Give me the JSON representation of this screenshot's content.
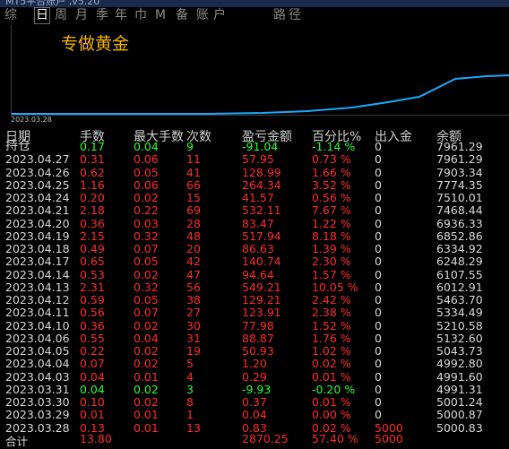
{
  "window": {
    "title": "MT5平台账户 ,v5.20"
  },
  "tabs": [
    {
      "label": "综",
      "active": false
    },
    {
      "label": "日",
      "active": true
    },
    {
      "label": "周",
      "active": false
    },
    {
      "label": "月",
      "active": false
    },
    {
      "label": "季",
      "active": false
    },
    {
      "label": "年",
      "active": false
    },
    {
      "label": "巾",
      "active": false
    },
    {
      "label": "M",
      "active": false
    },
    {
      "label": "备",
      "active": false
    },
    {
      "label": "账",
      "active": false
    },
    {
      "label": "户",
      "active": false
    },
    {
      "label": "路",
      "active": false
    },
    {
      "label": "径",
      "active": false
    }
  ],
  "chart": {
    "title": "专做黄金",
    "start_date": "2023.03.28",
    "line_color": "#1ea7ff"
  },
  "table": {
    "headers": [
      "日期",
      "手数",
      "最大手数",
      "次数",
      "盈亏金额",
      "百分比%",
      "出入金",
      "余额"
    ],
    "position_row": {
      "date": "持仓",
      "lots": "0.17",
      "max_lots": "0.04",
      "trades": "9",
      "profit": "-91.04",
      "percent": "-1.14 %",
      "deposit": "0",
      "balance": "7961.29"
    },
    "rows": [
      {
        "date": "2023.04.27",
        "lots": "0.31",
        "max_lots": "0.06",
        "trades": "11",
        "profit": "57.95",
        "percent": "0.73 %",
        "deposit": "0",
        "balance": "7961.29",
        "color": "red"
      },
      {
        "date": "2023.04.26",
        "lots": "0.62",
        "max_lots": "0.05",
        "trades": "41",
        "profit": "128.99",
        "percent": "1.66 %",
        "deposit": "0",
        "balance": "7903.34",
        "color": "red"
      },
      {
        "date": "2023.04.25",
        "lots": "1.16",
        "max_lots": "0.06",
        "trades": "66",
        "profit": "264.34",
        "percent": "3.52 %",
        "deposit": "0",
        "balance": "7774.35",
        "color": "red"
      },
      {
        "date": "2023.04.24",
        "lots": "0.20",
        "max_lots": "0.02",
        "trades": "15",
        "profit": "41.57",
        "percent": "0.56 %",
        "deposit": "0",
        "balance": "7510.01",
        "color": "red"
      },
      {
        "date": "2023.04.21",
        "lots": "2.18",
        "max_lots": "0.22",
        "trades": "69",
        "profit": "532.11",
        "percent": "7.67 %",
        "deposit": "0",
        "balance": "7468.44",
        "color": "red"
      },
      {
        "date": "2023.04.20",
        "lots": "0.36",
        "max_lots": "0.03",
        "trades": "28",
        "profit": "83.47",
        "percent": "1.22 %",
        "deposit": "0",
        "balance": "6936.33",
        "color": "red"
      },
      {
        "date": "2023.04.19",
        "lots": "2.15",
        "max_lots": "0.32",
        "trades": "48",
        "profit": "517.94",
        "percent": "8.18 %",
        "deposit": "0",
        "balance": "6852.86",
        "color": "red"
      },
      {
        "date": "2023.04.18",
        "lots": "0.49",
        "max_lots": "0.07",
        "trades": "20",
        "profit": "86.63",
        "percent": "1.39 %",
        "deposit": "0",
        "balance": "6334.92",
        "color": "red"
      },
      {
        "date": "2023.04.17",
        "lots": "0.65",
        "max_lots": "0.05",
        "trades": "42",
        "profit": "140.74",
        "percent": "2.30 %",
        "deposit": "0",
        "balance": "6248.29",
        "color": "red"
      },
      {
        "date": "2023.04.14",
        "lots": "0.53",
        "max_lots": "0.02",
        "trades": "47",
        "profit": "94.64",
        "percent": "1.57 %",
        "deposit": "0",
        "balance": "6107.55",
        "color": "red"
      },
      {
        "date": "2023.04.13",
        "lots": "2.31",
        "max_lots": "0.32",
        "trades": "56",
        "profit": "549.21",
        "percent": "10.05 %",
        "deposit": "0",
        "balance": "6012.91",
        "color": "red"
      },
      {
        "date": "2023.04.12",
        "lots": "0.59",
        "max_lots": "0.05",
        "trades": "38",
        "profit": "129.21",
        "percent": "2.42 %",
        "deposit": "0",
        "balance": "5463.70",
        "color": "red"
      },
      {
        "date": "2023.04.11",
        "lots": "0.56",
        "max_lots": "0.07",
        "trades": "27",
        "profit": "123.91",
        "percent": "2.38 %",
        "deposit": "0",
        "balance": "5334.49",
        "color": "red"
      },
      {
        "date": "2023.04.10",
        "lots": "0.36",
        "max_lots": "0.02",
        "trades": "30",
        "profit": "77.98",
        "percent": "1.52 %",
        "deposit": "0",
        "balance": "5210.58",
        "color": "red"
      },
      {
        "date": "2023.04.06",
        "lots": "0.55",
        "max_lots": "0.04",
        "trades": "31",
        "profit": "88.87",
        "percent": "1.76 %",
        "deposit": "0",
        "balance": "5132.60",
        "color": "red"
      },
      {
        "date": "2023.04.05",
        "lots": "0.22",
        "max_lots": "0.02",
        "trades": "19",
        "profit": "50.93",
        "percent": "1.02 %",
        "deposit": "0",
        "balance": "5043.73",
        "color": "red"
      },
      {
        "date": "2023.04.04",
        "lots": "0.07",
        "max_lots": "0.02",
        "trades": "5",
        "profit": "1.20",
        "percent": "0.02 %",
        "deposit": "0",
        "balance": "4992.80",
        "color": "red"
      },
      {
        "date": "2023.04.03",
        "lots": "0.04",
        "max_lots": "0.01",
        "trades": "4",
        "profit": "0.29",
        "percent": "0.01 %",
        "deposit": "0",
        "balance": "4991.60",
        "color": "red"
      },
      {
        "date": "2023.03.31",
        "lots": "0.04",
        "max_lots": "0.02",
        "trades": "3",
        "profit": "-9.93",
        "percent": "-0.20 %",
        "deposit": "0",
        "balance": "4991.31",
        "color": "green"
      },
      {
        "date": "2023.03.30",
        "lots": "0.10",
        "max_lots": "0.02",
        "trades": "8",
        "profit": "0.37",
        "percent": "0.01 %",
        "deposit": "0",
        "balance": "5001.24",
        "color": "red"
      },
      {
        "date": "2023.03.29",
        "lots": "0.01",
        "max_lots": "0.01",
        "trades": "1",
        "profit": "0.04",
        "percent": "0.00 %",
        "deposit": "0",
        "balance": "5000.87",
        "color": "red"
      },
      {
        "date": "2023.03.28",
        "lots": "0.13",
        "max_lots": "0.01",
        "trades": "13",
        "profit": "0.83",
        "percent": "0.02 %",
        "deposit": "5000",
        "balance": "5000.83",
        "color": "red"
      }
    ],
    "total_row": {
      "label": "合计",
      "lots": "13.80",
      "profit": "2870.25",
      "percent": "57.40 %",
      "deposit": "5000"
    }
  },
  "colors": {
    "profit": "#ff2a2a",
    "loss": "#2cff2c",
    "title": "#f5b400",
    "curve": "#1ea7ff"
  }
}
